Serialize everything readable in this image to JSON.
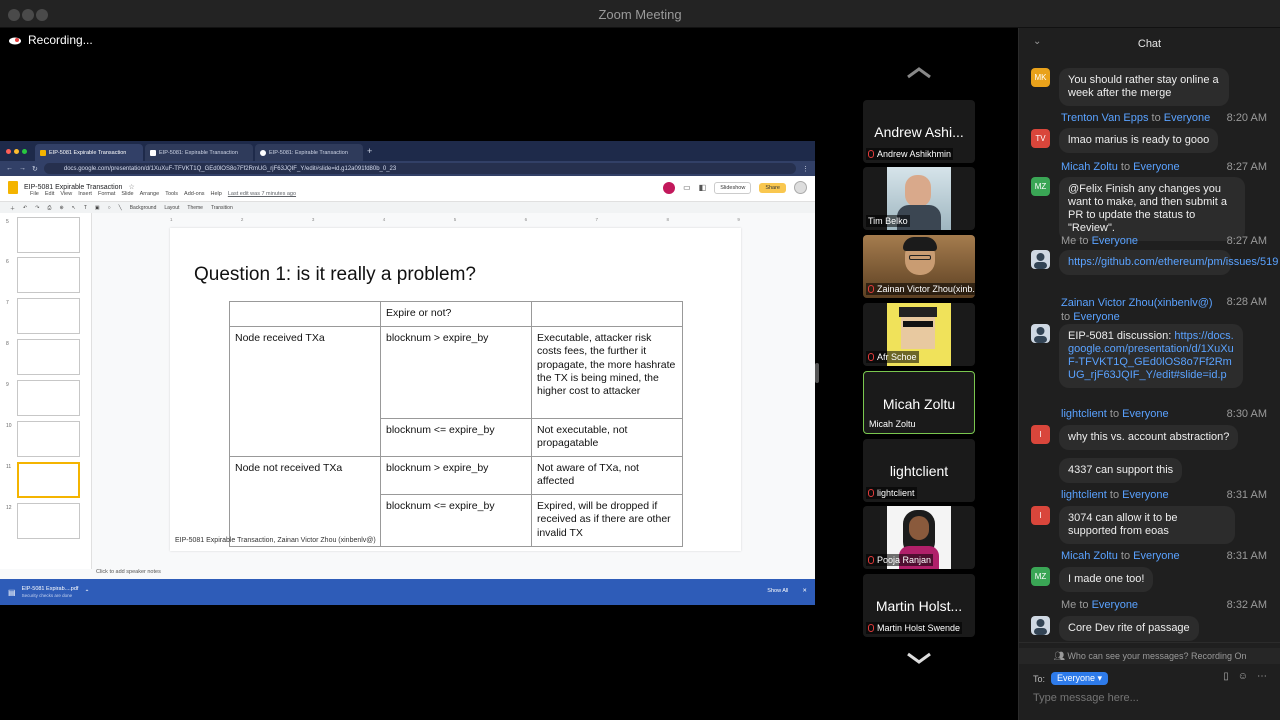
{
  "window": {
    "title": "Zoom Meeting",
    "recording": "Recording..."
  },
  "browser": {
    "tabs": [
      "EIP-5081 Expirable Transaction",
      "EIP-5081: Expirable Transaction",
      "EIP-5081: Expirable Transaction"
    ],
    "url": "docs.google.com/presentation/d/1XuXuF-TFVKT1Q_GEd0lOS8o7Ff2RmUG_rjF63JQIF_Y/edit#slide=id.g12a091fd80b_0_23"
  },
  "slides_app": {
    "doc_title": "EIP-5081 Expirable Transaction",
    "menus": [
      "File",
      "Edit",
      "View",
      "Insert",
      "Format",
      "Slide",
      "Arrange",
      "Tools",
      "Add-ons",
      "Help"
    ],
    "last_edit": "Last edit was 7 minutes ago",
    "slideshow_label": "Slideshow",
    "share_label": "Share",
    "toolbar": [
      "Background",
      "Layout",
      "Theme",
      "Transition"
    ],
    "thumb_numbers": [
      "5",
      "6",
      "7",
      "8",
      "9",
      "10",
      "11",
      "12"
    ],
    "speaker_notes": "Click to add speaker notes"
  },
  "slide": {
    "title": "Question 1: is it really a problem?",
    "footer": "EIP-5081 Expirable Transaction, Zainan Victor Zhou (xinbenlv@)",
    "table": {
      "header": [
        "",
        "Expire or not?",
        ""
      ],
      "rows": [
        [
          "Node received TXa",
          "blocknum > expire_by",
          "Executable, attacker risk costs fees, the further it propagate, the more hashrate the TX is being mined, the higher cost to attacker"
        ],
        [
          "",
          "blocknum <= expire_by",
          "Not executable, not propagatable"
        ],
        [
          "Node not received TXa",
          "blocknum > expire_by",
          "Not aware of TXa, not affected"
        ],
        [
          "",
          "blocknum <= expire_by",
          "Expired, will be dropped if received as if there are other invalid TX"
        ]
      ]
    }
  },
  "downloads": {
    "file": "EIP-5081 Expirab....pdf",
    "sub": "Security checks are done",
    "show_all": "Show All"
  },
  "participants": [
    {
      "name_large": "Andrew Ashi...",
      "label": "Andrew Ashikhmin",
      "video": false
    },
    {
      "name_large": "",
      "label": "Tim Belko",
      "video": true
    },
    {
      "name_large": "",
      "label": "Zainan Victor Zhou(xinb...",
      "video": true
    },
    {
      "name_large": "",
      "label": "Afr Schoe",
      "video": true
    },
    {
      "name_large": "Micah Zoltu",
      "label": "Micah Zoltu",
      "video": false
    },
    {
      "name_large": "lightclient",
      "label": "lightclient",
      "video": false
    },
    {
      "name_large": "",
      "label": "Pooja Ranjan",
      "video": true
    },
    {
      "name_large": "Martin Holst...",
      "label": "Martin Holst Swende",
      "video": false
    }
  ],
  "chat": {
    "title": "Chat",
    "messages": [
      {
        "avatar": "MK",
        "text": "You should rather stay online a week after the merge"
      },
      {
        "avatar": "TV",
        "from": "Trenton Van Epps",
        "to": "Everyone",
        "time": "8:20 AM",
        "text": "lmao marius is ready to gooo"
      },
      {
        "avatar": "MZ",
        "from": "Micah Zoltu",
        "to": "Everyone",
        "time": "8:27 AM",
        "text": "@Felix Finish any changes you want to make, and then submit a PR to update the status to \"Review\"."
      },
      {
        "avatar": "",
        "from": "Me",
        "to": "Everyone",
        "time": "8:27 AM",
        "text": "https://github.com/ethereum/pm/issues/519"
      },
      {
        "avatar": "",
        "from": "Zainan Victor Zhou(xinbenlv@)",
        "to": "Everyone",
        "time": "8:28 AM",
        "text_prefix": "EIP-5081 discussion: ",
        "link": "https://docs.google.com/presentation/d/1XuXuF-TFVKT1Q_GEd0lOS8o7Ff2RmUG_rjF63JQIF_Y/edit#slide=id.p"
      },
      {
        "avatar": "l",
        "from": "lightclient",
        "to": "Everyone",
        "time": "8:30 AM",
        "text": "why this vs. account abstraction?",
        "text2": "4337 can support this"
      },
      {
        "avatar": "l",
        "from": "lightclient",
        "to": "Everyone",
        "time": "8:31 AM",
        "text": "3074 can allow it to be supported from eoas"
      },
      {
        "avatar": "MZ",
        "from": "Micah Zoltu",
        "to": "Everyone",
        "time": "8:31 AM",
        "text": "I made one too!"
      },
      {
        "avatar": "",
        "from": "Me",
        "to": "Everyone",
        "time": "8:32 AM",
        "text": "Core Dev rite of passage"
      }
    ],
    "privacy": "Who can see your messages? Recording On",
    "to_label": "To:",
    "to_value": "Everyone",
    "placeholder": "Type message here..."
  },
  "colors": {
    "accent": "#2e7bea",
    "link": "#5aa2ff",
    "active_speaker": "#7ac74f",
    "mute": "#e23b3b"
  }
}
